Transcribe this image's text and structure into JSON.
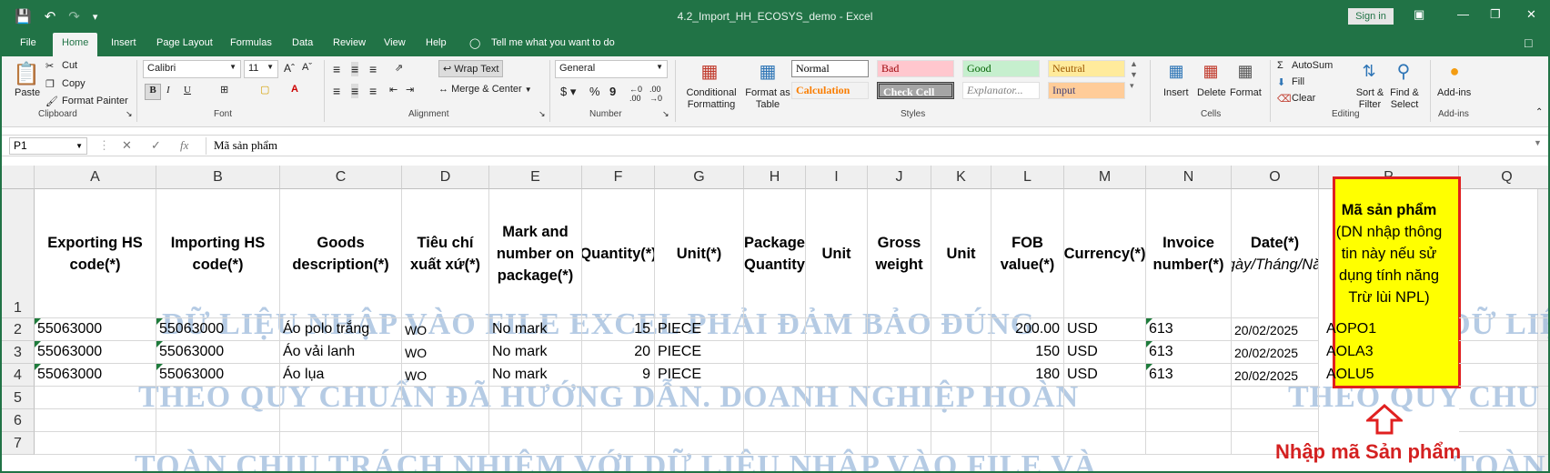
{
  "window": {
    "title": "4.2_Import_HH_ECOSYS_demo  -  Excel",
    "sign_in": "Sign in"
  },
  "tabs": [
    "File",
    "Home",
    "Insert",
    "Page Layout",
    "Formulas",
    "Data",
    "Review",
    "View",
    "Help"
  ],
  "tell_me": "Tell me what you want to do",
  "ribbon": {
    "clipboard": {
      "paste": "Paste",
      "cut": "Cut",
      "copy": "Copy",
      "format_painter": "Format Painter",
      "label": "Clipboard"
    },
    "font": {
      "name": "Calibri",
      "size": "11",
      "label": "Font"
    },
    "alignment": {
      "wrap_text": "Wrap Text",
      "merge": "Merge & Center",
      "label": "Alignment"
    },
    "number": {
      "format": "General",
      "label": "Number"
    },
    "styles": {
      "conditional": "Conditional Formatting",
      "format_table": "Format as Table",
      "cells": [
        {
          "name": "Normal",
          "bg": "#ffffff",
          "color": "#000000"
        },
        {
          "name": "Bad",
          "bg": "#ffc7ce",
          "color": "#9c0006"
        },
        {
          "name": "Good",
          "bg": "#c6efce",
          "color": "#006100"
        },
        {
          "name": "Neutral",
          "bg": "#ffeb9c",
          "color": "#9c5700"
        },
        {
          "name": "Calculation",
          "bg": "#f2f2f2",
          "color": "#fa7d00"
        },
        {
          "name": "Check Cell",
          "bg": "#a5a5a5",
          "color": "#ffffff"
        },
        {
          "name": "Explanator...",
          "bg": "#ffffff",
          "color": "#7f7f7f"
        },
        {
          "name": "Input",
          "bg": "#ffcc99",
          "color": "#3f3f76"
        }
      ],
      "label": "Styles"
    },
    "cells": {
      "insert": "Insert",
      "delete": "Delete",
      "format": "Format",
      "label": "Cells"
    },
    "editing": {
      "autosum": "AutoSum",
      "fill": "Fill",
      "clear": "Clear",
      "sort": "Sort & Filter",
      "find": "Find & Select",
      "label": "Editing"
    },
    "addins": {
      "button": "Add-ins",
      "label": "Add-ins"
    }
  },
  "formula_bar": {
    "name_box": "P1",
    "content": "Mã sản phẩm"
  },
  "columns": [
    "A",
    "B",
    "C",
    "D",
    "E",
    "F",
    "G",
    "H",
    "I",
    "J",
    "K",
    "L",
    "M",
    "N",
    "O",
    "P",
    "Q"
  ],
  "rows": [
    "1",
    "2",
    "3",
    "4",
    "5",
    "6",
    "7"
  ],
  "headers": {
    "A": "Exporting HS code(*)",
    "B": "Importing HS code(*)",
    "C": "Goods description(*)",
    "D": "Tiêu chí xuất xứ(*)",
    "E": "Mark and number on package(*)",
    "F": "Quantity(*)",
    "G": "Unit(*)",
    "H": "Package Quantity",
    "I": "Unit",
    "J": "Gross weight",
    "K": "Unit",
    "L": "FOB value(*)",
    "M": "Currency(*)",
    "N": "Invoice number(*)",
    "O_main": "Date(*)",
    "O_sub": "(Ngày/Tháng/Năm)",
    "P_main": "Mã sản phẩm",
    "P_sub": "(DN nhập thông tin này nếu sử dụng tính năng Trừ lùi NPL)"
  },
  "data_rows": [
    {
      "A": "55063000",
      "B": "55063000",
      "C": "Áo polo trắng",
      "D": "WO",
      "E": "No mark",
      "F": "15",
      "G": "PIECE",
      "L": "200.00",
      "M": "USD",
      "N": "613",
      "O": "20/02/2025",
      "P": "AOPO1"
    },
    {
      "A": "55063000",
      "B": "55063000",
      "C": "Áo vải lanh",
      "D": "WO",
      "E": "No mark",
      "F": "20",
      "G": "PIECE",
      "L": "150",
      "M": "USD",
      "N": "613",
      "O": "20/02/2025",
      "P": "AOLA3"
    },
    {
      "A": "55063000",
      "B": "55063000",
      "C": "Áo lụa",
      "D": "WO",
      "E": "No mark",
      "F": "9",
      "G": "PIECE",
      "L": "180",
      "M": "USD",
      "N": "613",
      "O": "20/02/2025",
      "P": "AOLU5"
    }
  ],
  "watermark": {
    "line1": "DỮ LIỆU NHẬP VÀO FILE EXCEL PHẢI ĐẢM BẢO ĐÚNG",
    "line2": "THEO QUY CHUẨN ĐÃ HƯỚNG DẪN. DOANH NGHIỆP HOÀN",
    "line3": "TOÀN CHỊU TRÁCH NHIỆM VỚI DỮ LIỆU NHẬP VÀO FILE VÀ",
    "right1": "DỮ LIỆU NHẬ",
    "right2": "THEO QUY CHU",
    "right3": "TOÀN CHỊU TRÁ"
  },
  "annotation": "Nhập mã Sản phẩm"
}
